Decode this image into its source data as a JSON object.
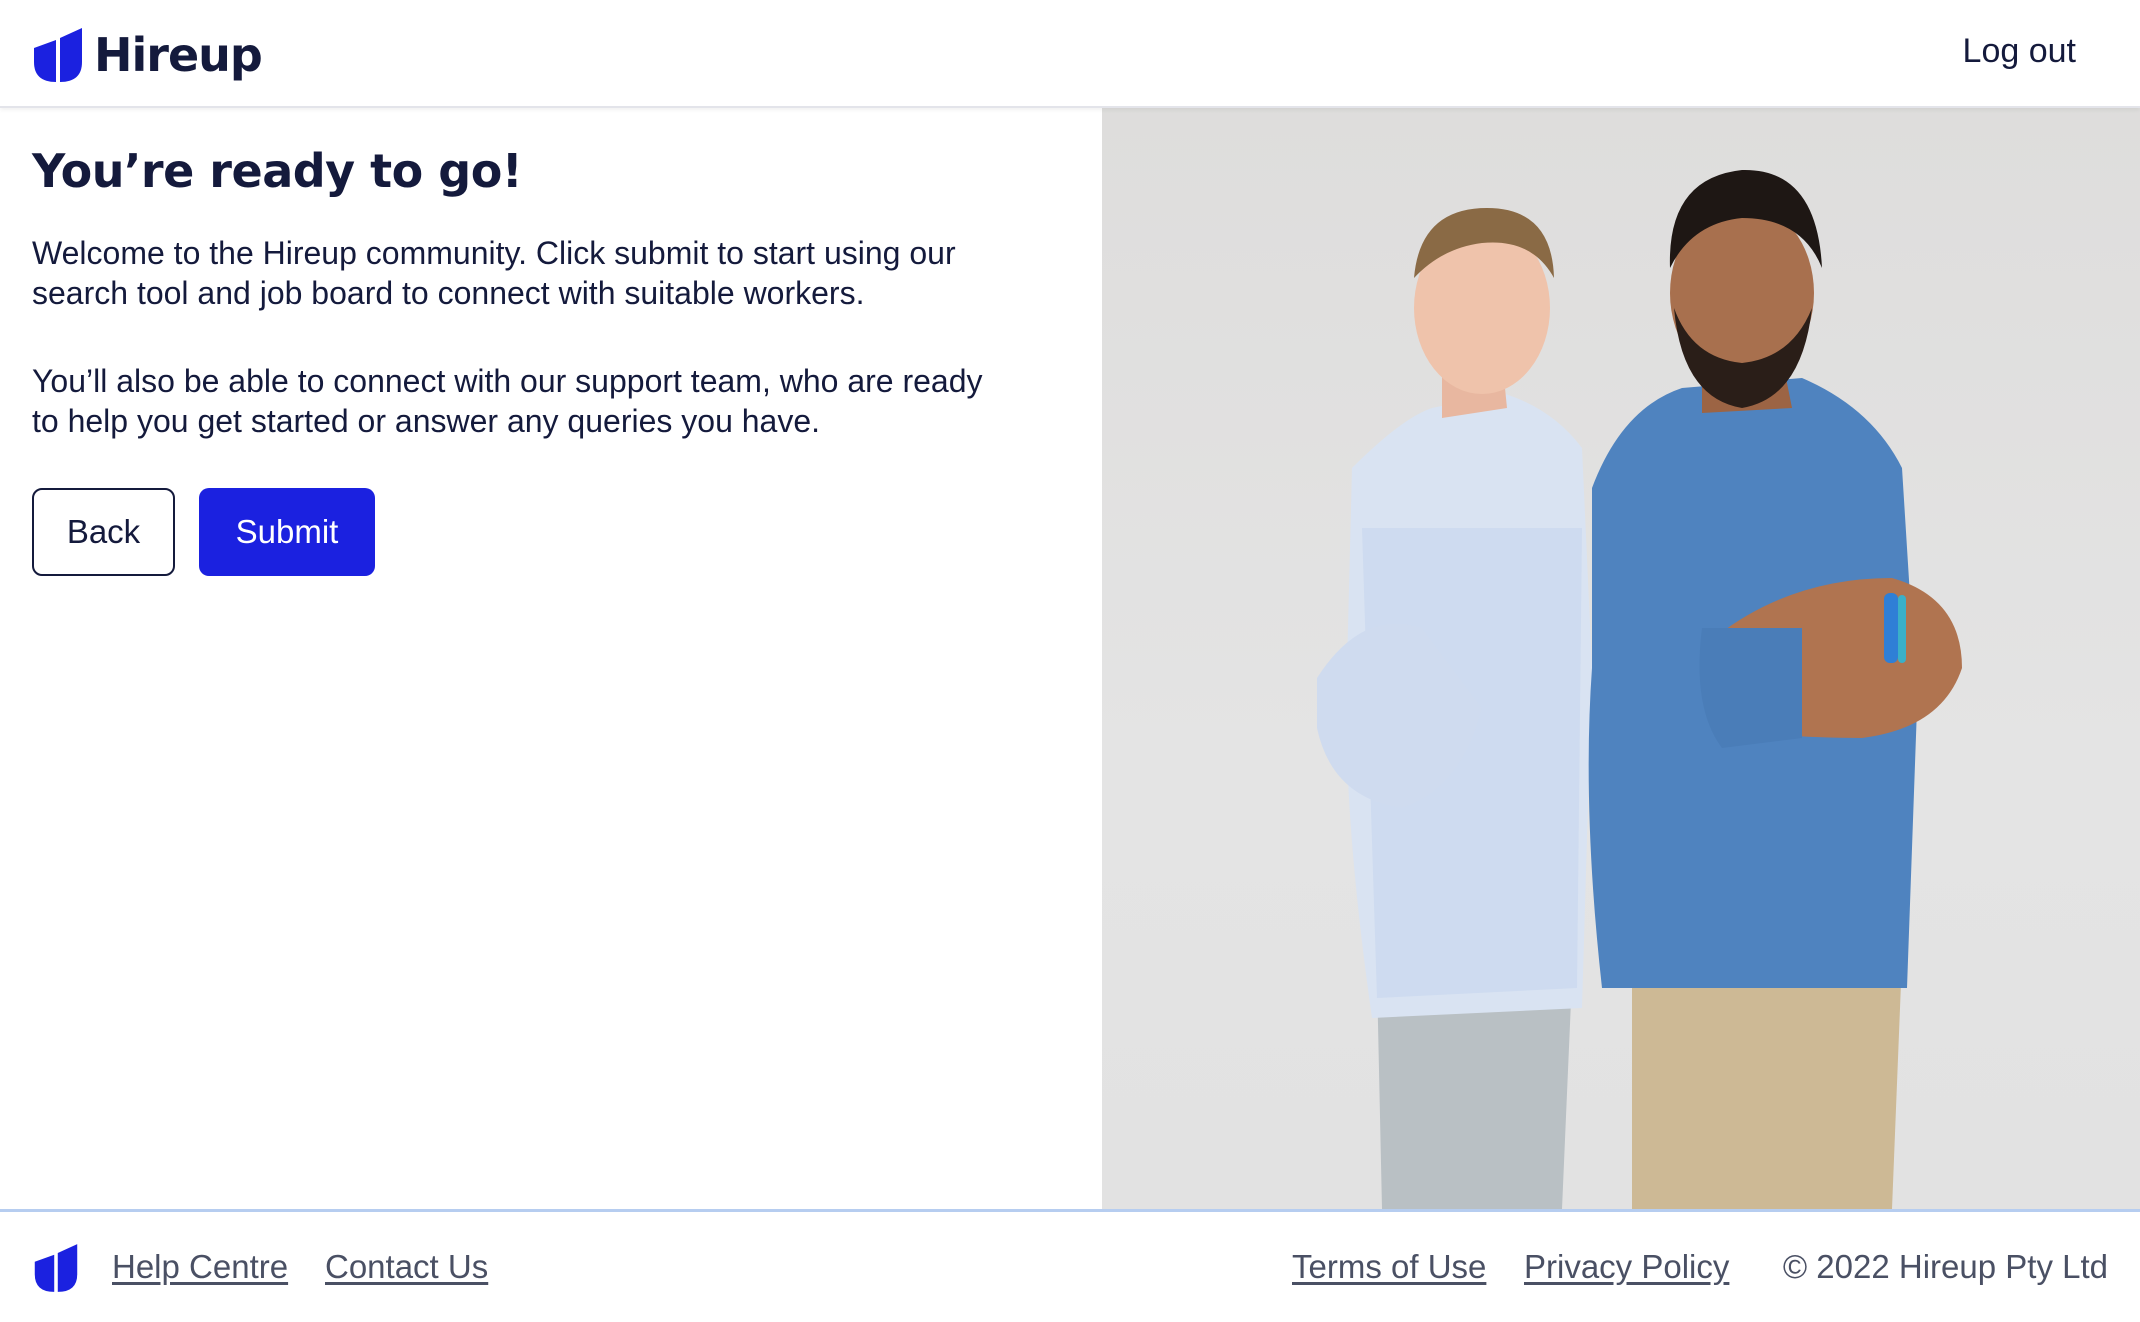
{
  "header": {
    "brand_name": "Hireup",
    "logout_label": "Log out"
  },
  "main": {
    "title": "You’re ready to go!",
    "paragraph_1": "Welcome to the Hireup community. Click submit to start using our search tool and job board to connect with suitable workers.",
    "paragraph_2": "You’ll also be able to connect with our support team, who are ready to help you get started or answer any queries you have.",
    "back_label": "Back",
    "submit_label": "Submit"
  },
  "footer": {
    "help_label": "Help Centre",
    "contact_label": "Contact Us",
    "terms_label": "Terms of Use",
    "privacy_label": "Privacy Policy",
    "copyright": "© 2022 Hireup Pty Ltd"
  },
  "colors": {
    "brand_blue": "#1b21e0",
    "text_dark": "#141a3c",
    "footer_text": "#4a5064"
  },
  "icons": {
    "logo": "hireup-logo-icon"
  }
}
